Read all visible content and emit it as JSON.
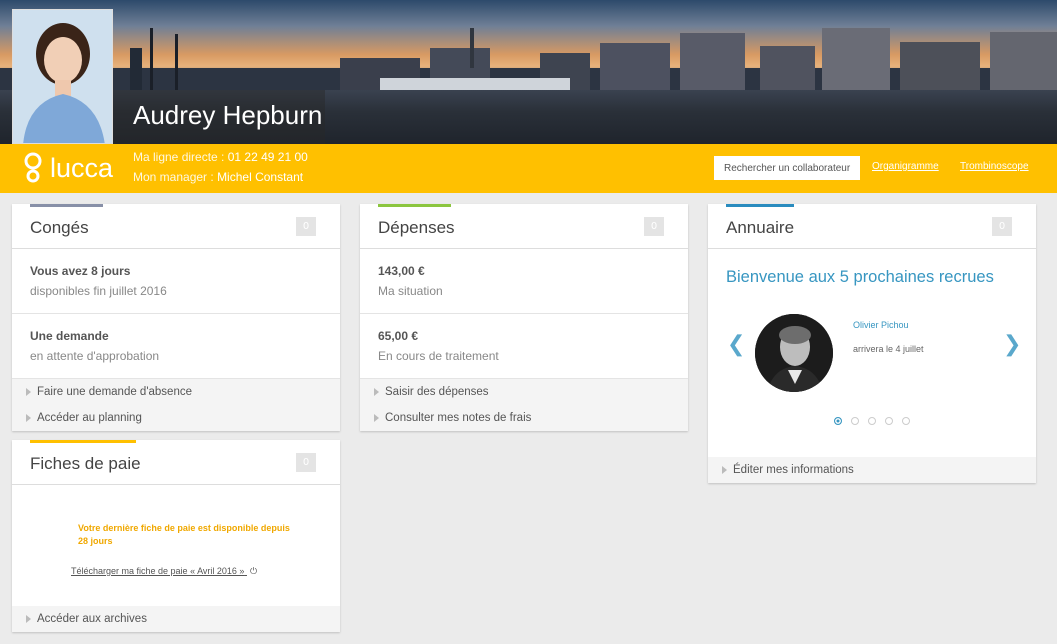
{
  "profile": {
    "name": "Audrey Hepburn",
    "direct_line_label": "Ma ligne directe :",
    "direct_line": "01 22 49 21 00",
    "manager_label": "Mon manager :",
    "manager": "Michel Constant"
  },
  "brand": {
    "logo": "lucca",
    "color": "#ffc000"
  },
  "header": {
    "search_placeholder": "Rechercher un collaborateur",
    "links": [
      "Organigramme",
      "Trombinoscope"
    ]
  },
  "conges": {
    "title": "Congés",
    "count": "0",
    "accent": "#8890a8",
    "rows": [
      {
        "value": "Vous avez 8 jours",
        "sub": "disponibles fin juillet 2016"
      },
      {
        "value": "Une demande",
        "sub": "en attente d'approbation"
      }
    ],
    "actions": [
      "Faire une demande d'absence",
      "Accéder au planning"
    ]
  },
  "depenses": {
    "title": "Dépenses",
    "count": "0",
    "accent": "#8cc63f",
    "rows": [
      {
        "value": "143,00 €",
        "sub": "Ma situation"
      },
      {
        "value": "65,00 €",
        "sub": "En cours de traitement"
      }
    ],
    "actions": [
      "Saisir des dépenses",
      "Consulter mes notes de frais"
    ]
  },
  "annuaire": {
    "title": "Annuaire",
    "count": "0",
    "accent": "#2a8cbf",
    "welcome": "Bienvenue aux 5 prochaines recrues",
    "recruit_name": "Olivier Pichou",
    "recruit_date": "arrivera le 4 juillet",
    "actions": [
      "Éditer mes informations"
    ]
  },
  "paie": {
    "title": "Fiches de paie",
    "count": "0",
    "accent": "#ffc000",
    "message": "Votre dernière fiche de paie est disponible depuis 28 jours",
    "download": "Télécharger ma fiche de paie « Avril 2016 »",
    "actions": [
      "Accéder aux archives"
    ]
  }
}
